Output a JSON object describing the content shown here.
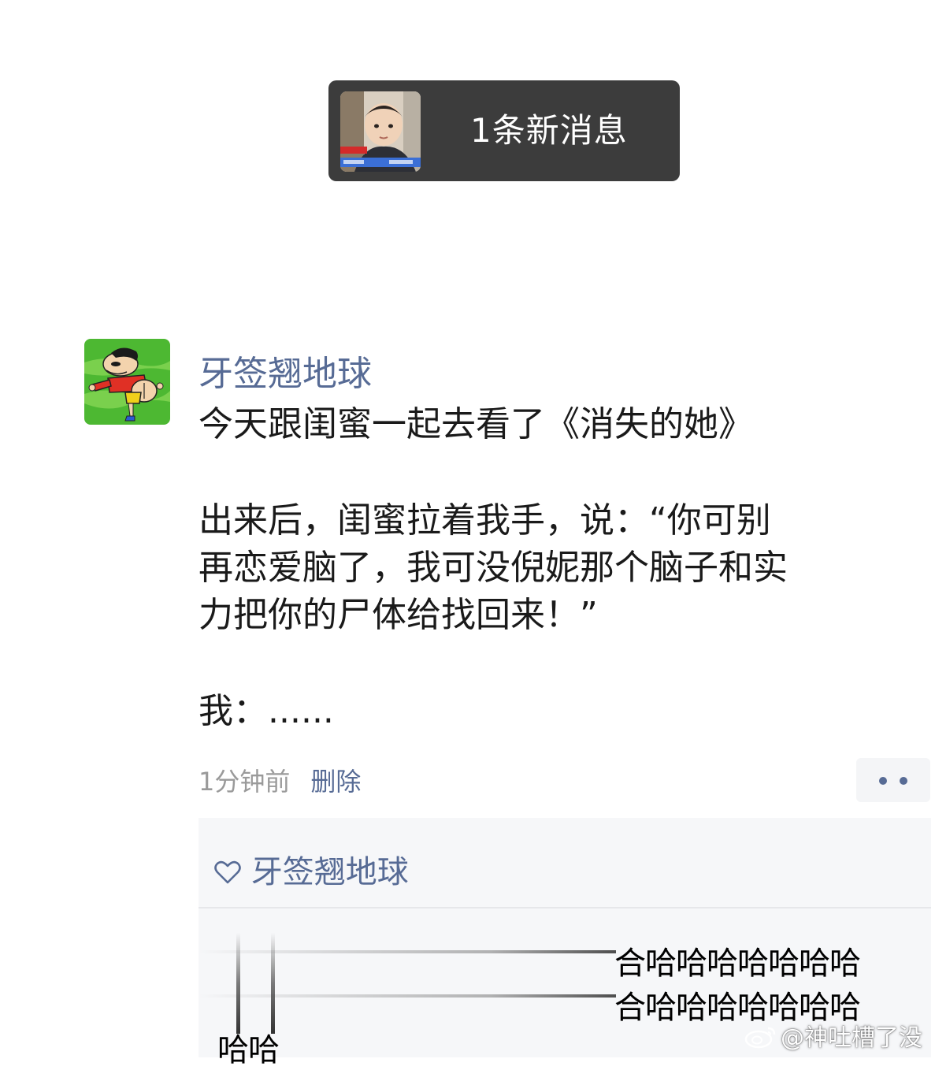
{
  "notification": {
    "text": "1条新消息"
  },
  "post": {
    "author": "牙签翘地球",
    "lines": [
      "今天跟闺蜜一起去看了《消失的她》",
      "出来后，闺蜜拉着我手，说：“你可别",
      "再恋爱脑了，我可没倪妮那个脑子和实",
      "力把你的尸体给找回来！”",
      "我：......"
    ],
    "time_ago": "1分钟前",
    "delete_label": "删除"
  },
  "likes": {
    "names": "牙签翘地球"
  },
  "comment_art": {
    "line1": "合哈哈哈哈哈哈哈",
    "line2": "合哈哈哈哈哈哈哈",
    "bottom": "哈哈"
  },
  "watermark": {
    "text": "@神吐槽了没"
  },
  "colors": {
    "link_blue": "#576b95",
    "pill_bg": "#3c3c3c",
    "panel_bg": "#f6f7f9"
  }
}
